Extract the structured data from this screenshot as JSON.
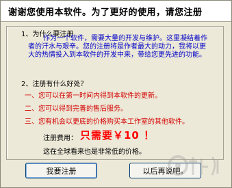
{
  "header": {
    "title": "谢谢您使用本软件。为了更好的使用，请您注册"
  },
  "section1": {
    "title": "1、为什么要注册",
    "body": "作为一个软件，需要大量的开发与维护。这里凝结着作者的汗水与艰辛。您的注册将是作者最大的动力，我将以更大的热情投入到本软件的开发中来，带给您更先进的功能。"
  },
  "section2": {
    "title": "2、注册有什么好处？",
    "items": [
      "一、您可以在第一时间内得到本软件的更新。",
      "二、您可以得到完善的售后服务。",
      "三、您有机会以更底的价格购买本工作室的其他软件。"
    ]
  },
  "fee": {
    "label": "注册费用：",
    "value": "只需要￥10 ！",
    "note": "这在全球看来也是非常低的价格。"
  },
  "buttons": {
    "register": "我要注册",
    "later": "以后再说吧。"
  },
  "colors": {
    "body_text": "#0000c8",
    "benefit_text": "#d40000",
    "price_text": "#ff0000",
    "dialog_bg": "#ece9d8"
  }
}
